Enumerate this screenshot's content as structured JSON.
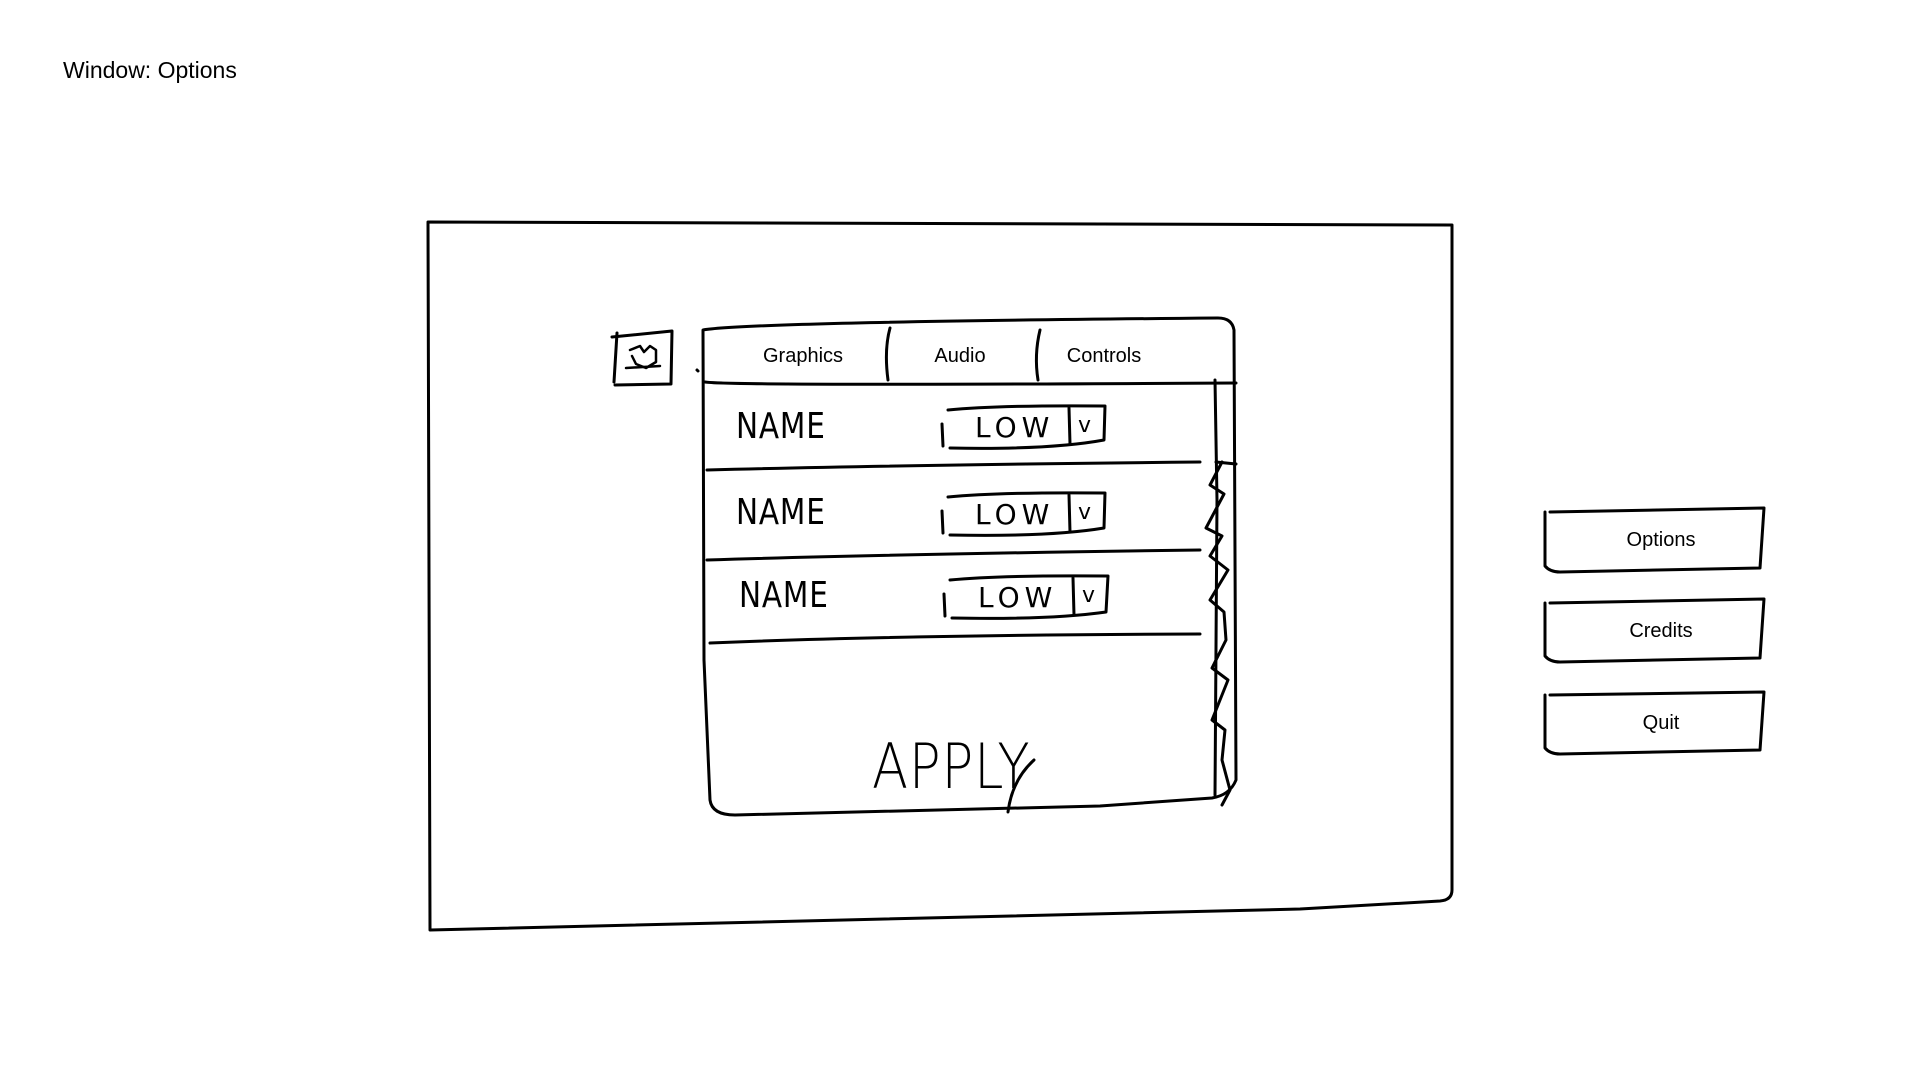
{
  "caption": "Window: Options",
  "panel": {
    "tabs": [
      {
        "label": "Graphics"
      },
      {
        "label": "Audio"
      },
      {
        "label": "Controls"
      }
    ],
    "rows": [
      {
        "name": "NAME",
        "value": "LOW",
        "dropdown_glyph": "v"
      },
      {
        "name": "NAME",
        "value": "LOW",
        "dropdown_glyph": "v"
      },
      {
        "name": "NAME",
        "value": "LOW",
        "dropdown_glyph": "v"
      }
    ],
    "apply_label": "APPLY",
    "image_placeholder_icon": "image-placeholder-icon"
  },
  "side_menu": {
    "options_label": "Options",
    "credits_label": "Credits",
    "quit_label": "Quit"
  }
}
